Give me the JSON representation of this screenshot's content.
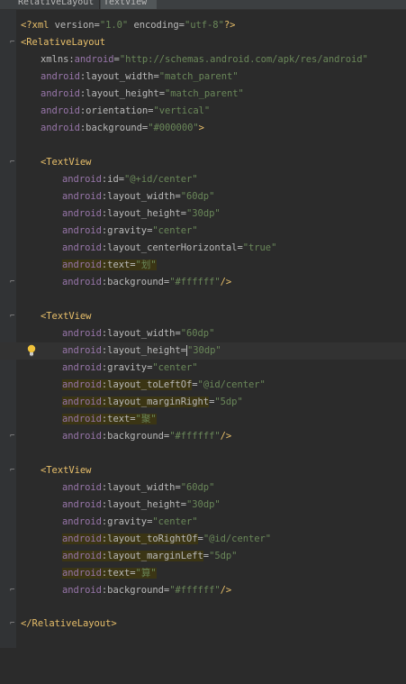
{
  "tabs": [
    {
      "label": "RelativeLayout"
    },
    {
      "label": "TextView"
    }
  ],
  "code": {
    "xml_decl": {
      "open": "<?xml ",
      "v_attr": "version",
      "v_val": "\"1.0\"",
      "e_attr": "encoding",
      "e_val": "\"utf-8\"",
      "close": "?>"
    },
    "root_open": "<RelativeLayout",
    "root_attrs": [
      {
        "ns": "xmlns:",
        "ns2": "android",
        "eq": "=",
        "val": "\"http://schemas.android.com/apk/res/android\""
      },
      {
        "ns": "android",
        "name": ":layout_width",
        "eq": "=",
        "val": "\"match_parent\""
      },
      {
        "ns": "android",
        "name": ":layout_height",
        "eq": "=",
        "val": "\"match_parent\""
      },
      {
        "ns": "android",
        "name": ":orientation",
        "eq": "=",
        "val": "\"vertical\""
      },
      {
        "ns": "android",
        "name": ":background",
        "eq": "=",
        "val": "\"#000000\"",
        "end": ">"
      }
    ],
    "textview_open": "<TextView",
    "tv1": [
      {
        "ns": "android",
        "name": ":id",
        "val": "\"@+id/center\""
      },
      {
        "ns": "android",
        "name": ":layout_width",
        "val": "\"60dp\""
      },
      {
        "ns": "android",
        "name": ":layout_height",
        "val": "\"30dp\""
      },
      {
        "ns": "android",
        "name": ":gravity",
        "val": "\"center\""
      },
      {
        "ns": "android",
        "name": ":layout_centerHorizontal",
        "val": "\"true\""
      },
      {
        "ns": "android",
        "name": ":text",
        "val": "\"划\""
      },
      {
        "ns": "android",
        "name": ":background",
        "val": "\"#ffffff\"",
        "end": "/>"
      }
    ],
    "tv2": [
      {
        "ns": "android",
        "name": ":layout_width",
        "val": "\"60dp\""
      },
      {
        "ns": "android",
        "name": ":layout_height",
        "val": "\"30dp\""
      },
      {
        "ns": "android",
        "name": ":gravity",
        "val": "\"center\""
      },
      {
        "ns": "android",
        "name": ":layout_toLeftOf",
        "val": "\"@id/center\""
      },
      {
        "ns": "android",
        "name": ":layout_marginRight",
        "val": "\"5dp\""
      },
      {
        "ns": "android",
        "name": ":text",
        "val": "\"聚\""
      },
      {
        "ns": "android",
        "name": ":background",
        "val": "\"#ffffff\"",
        "end": "/>"
      }
    ],
    "tv3": [
      {
        "ns": "android",
        "name": ":layout_width",
        "val": "\"60dp\""
      },
      {
        "ns": "android",
        "name": ":layout_height",
        "val": "\"30dp\""
      },
      {
        "ns": "android",
        "name": ":gravity",
        "val": "\"center\""
      },
      {
        "ns": "android",
        "name": ":layout_toRightOf",
        "val": "\"@id/center\""
      },
      {
        "ns": "android",
        "name": ":layout_marginLeft",
        "val": "\"5dp\""
      },
      {
        "ns": "android",
        "name": ":text",
        "val": "\"算\""
      },
      {
        "ns": "android",
        "name": ":background",
        "val": "\"#ffffff\"",
        "end": "/>"
      }
    ],
    "eq": "=",
    "root_close": "</RelativeLayout>"
  },
  "icons": {
    "fold": "fold-marker-icon",
    "intention": "lightbulb-icon"
  },
  "colors": {
    "background": "#2b2b2b",
    "tag": "#e8bf6a",
    "namespace": "#9876aa",
    "value": "#6a8759",
    "attribute": "#bababa"
  }
}
